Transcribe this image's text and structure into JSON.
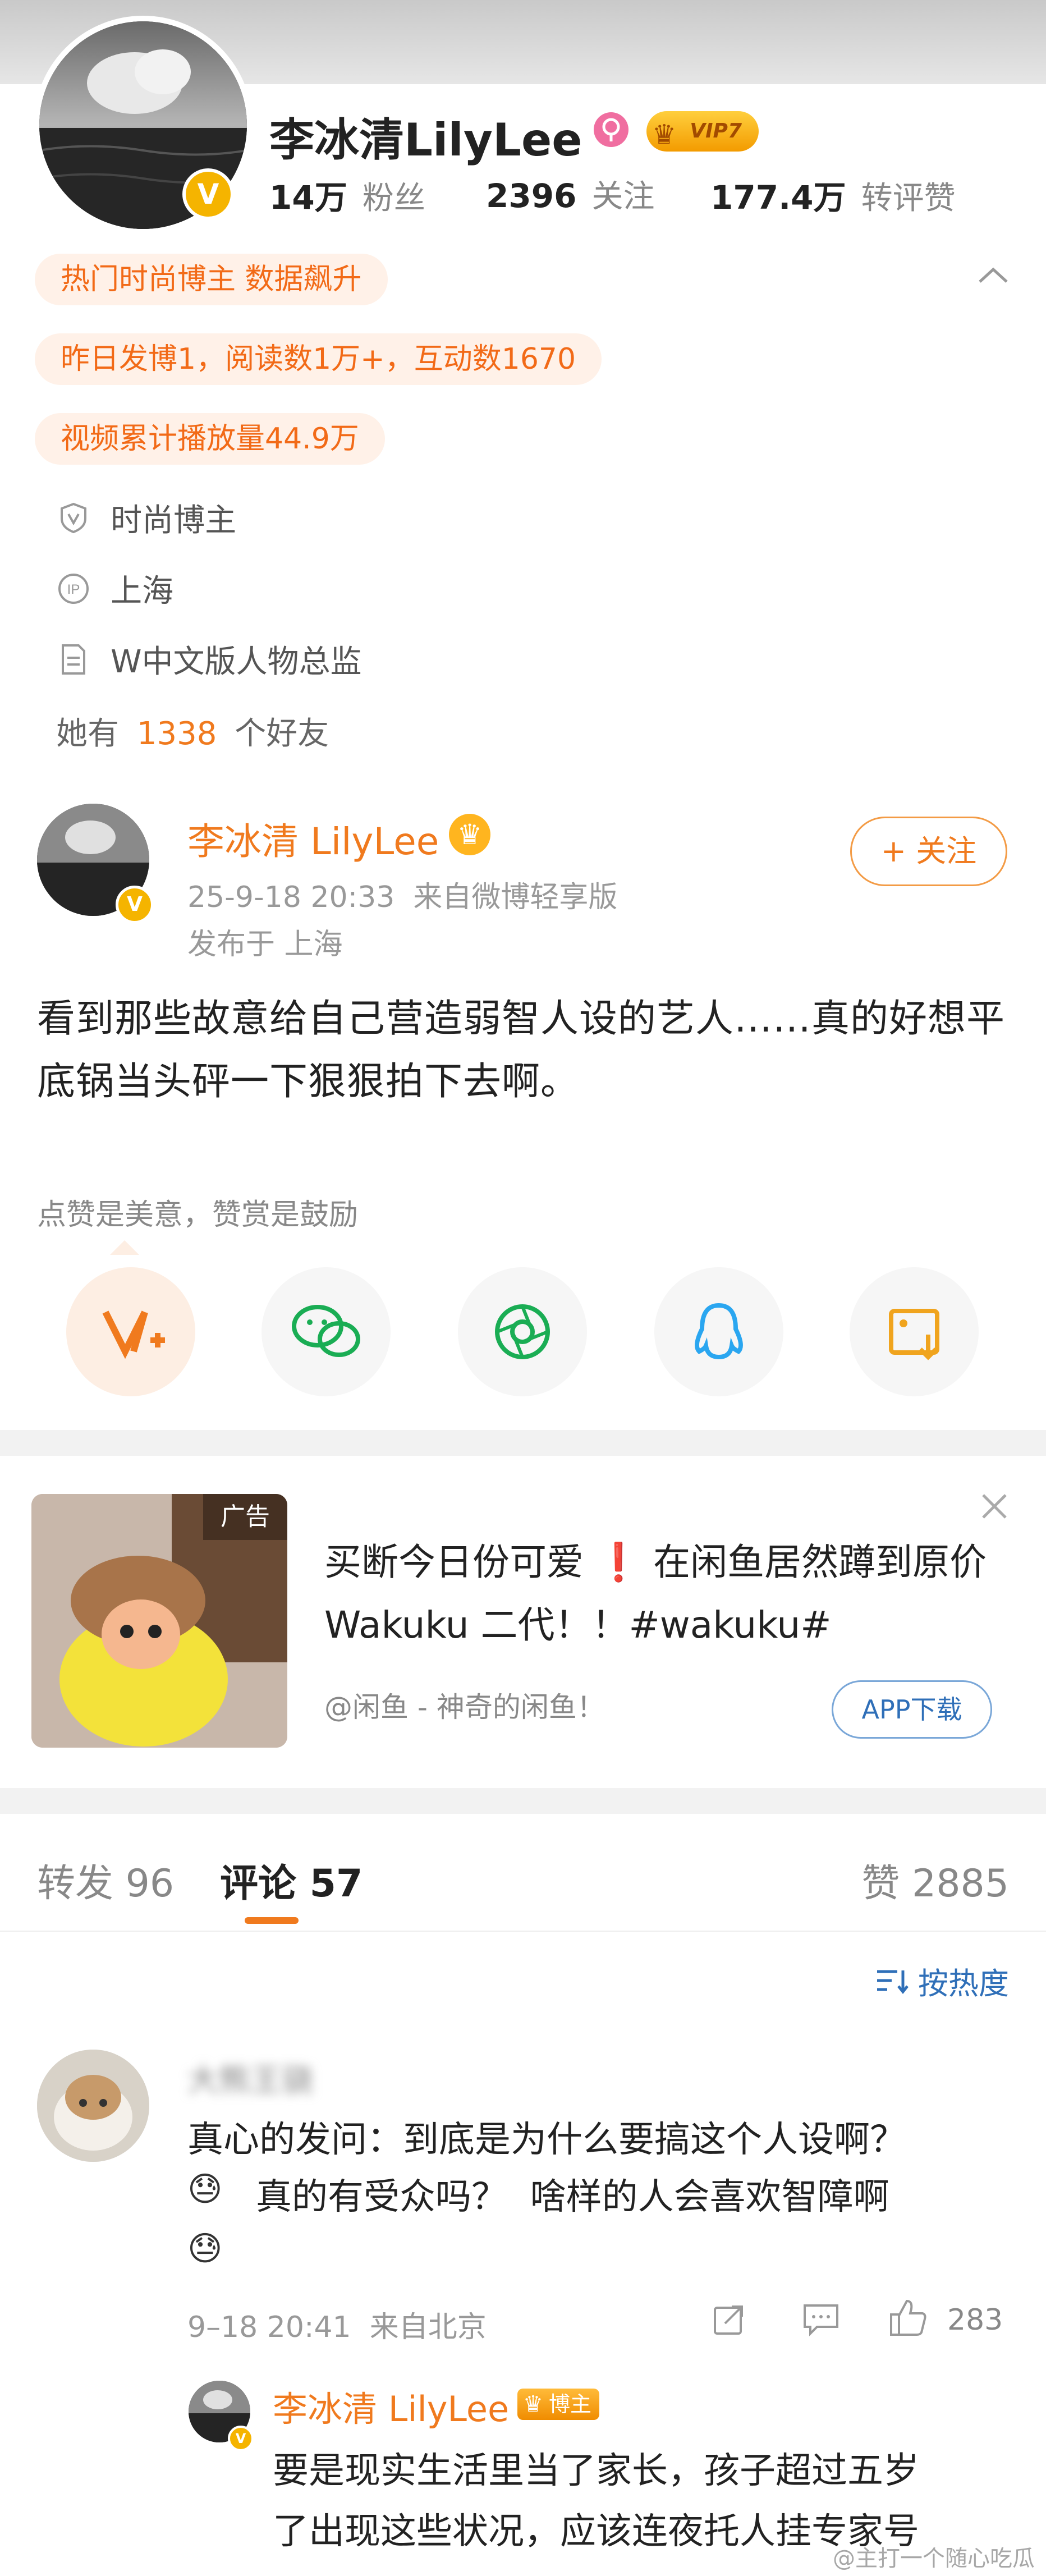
{
  "profile": {
    "name": "李冰清LilyLee",
    "vip_label": "VIP7",
    "verified_badge": "V",
    "stats": [
      {
        "num": "14万",
        "label": "粉丝"
      },
      {
        "num": "2396",
        "label": "关注"
      },
      {
        "num": "177.4万",
        "label": "转评赞"
      }
    ],
    "tags": [
      "热门时尚博主 数据飙升",
      "昨日发博1，阅读数1万+，互动数1670",
      "视频累计播放量44.9万"
    ],
    "info": [
      {
        "icon": "shield-v-icon",
        "text": "时尚博主"
      },
      {
        "icon": "ip-icon",
        "text": "上海"
      },
      {
        "icon": "document-icon",
        "text": "W中文版人物总监"
      }
    ],
    "friends_prefix": "她有",
    "friends_count": "1338",
    "friends_suffix": "个好友"
  },
  "post": {
    "author": "李冰清 LilyLee",
    "time_source": "25-9-18 20:33  来自微博轻享版",
    "location": "发布于 上海",
    "follow_label": "+ 关注",
    "text": "看到那些故意给自己营造弱智人设的艺人……真的好想平底锅当头砰一下狠狠拍下去啊。",
    "reward_hint": "点赞是美意，赞赏是鼓励",
    "share_icons": [
      "reward-v-icon",
      "wechat-icon",
      "moments-icon",
      "qq-icon",
      "save-image-icon"
    ]
  },
  "ad": {
    "tag": "广告",
    "text_before": "买断今日份可爱",
    "exclaim": "❗",
    "text_after": "在闲鱼居然蹲到原价 Wakuku 二代！！#wakuku#",
    "source": "@闲鱼 - 神奇的闲鱼！",
    "button": "APP下载",
    "close_icon": "close-icon"
  },
  "tabs": {
    "repost": "转发 96",
    "comment": "评论 57",
    "likes": "赞 2885",
    "sort": "按热度"
  },
  "comment": {
    "username": "大熊王骁",
    "text_line1": "真心的发问：到底是为什么要搞这个人设啊？",
    "text_line2": "真的有受众吗？  啥样的人会喜欢智障啊",
    "meta": "9–18 20:41  来自北京",
    "likes": "283"
  },
  "reply": {
    "author": "李冰清 LilyLee",
    "badge": "博主",
    "text_line1": "要是现实生活里当了家长，孩子超过五岁",
    "text_line2": "了出现这些状况，应该连夜托人挂专家号"
  },
  "watermark": "@主打一个随心吃瓜",
  "colors": {
    "accent": "#f07a1e",
    "vip": "#f5a300",
    "blue": "#2f6fb8"
  }
}
